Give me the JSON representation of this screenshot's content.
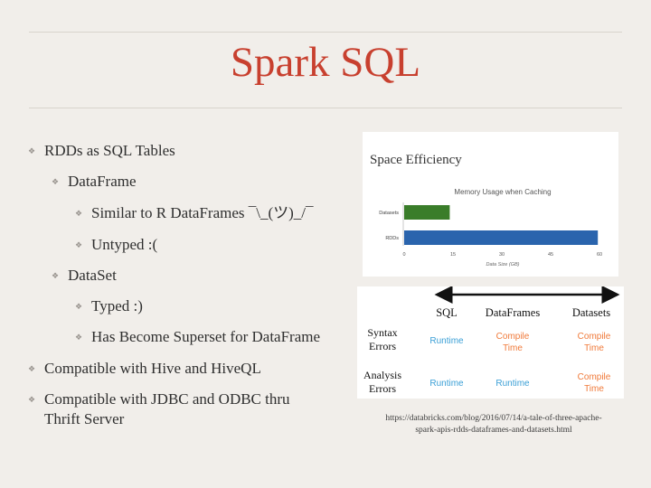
{
  "slide": {
    "title": "Spark SQL",
    "bullets": [
      {
        "text": "RDDs as SQL Tables"
      },
      {
        "text": "DataFrame"
      },
      {
        "text": "Similar to R DataFrames ¯\\_(ツ)_/¯"
      },
      {
        "text": "Untyped :("
      },
      {
        "text": "DataSet"
      },
      {
        "text": "Typed :)"
      },
      {
        "text": "Has Become Superset for DataFrame"
      },
      {
        "text": "Compatible with Hive and HiveQL"
      },
      {
        "text": "Compatible with JDBC and ODBC thru",
        "text2": "Thrift Server"
      }
    ],
    "source_url_line1": "https://databricks.com/blog/2016/07/14/a-tale-of-three-apache-",
    "source_url_line2": "spark-apis-rdds-dataframes-and-datasets.html"
  },
  "chart_data": {
    "type": "bar",
    "orientation": "horizontal",
    "panel_title": "Space Efficiency",
    "title": "Memory Usage when Caching",
    "xlabel": "Data Size (GB)",
    "ylabel": "",
    "categories": [
      "Datasets",
      "RDDs"
    ],
    "values": [
      14,
      59.5
    ],
    "colors": [
      "#3a7d2a",
      "#2a64ad"
    ],
    "xlim": [
      0,
      60
    ],
    "xticks": [
      0,
      15,
      30,
      45,
      60
    ],
    "grid": false
  },
  "comparison": {
    "columns": [
      "SQL",
      "DataFrames",
      "Datasets"
    ],
    "rows": [
      {
        "label": [
          "Syntax",
          "Errors"
        ],
        "cells": [
          [
            "Runtime"
          ],
          [
            "Compile",
            "Time"
          ],
          [
            "Compile",
            "Time"
          ]
        ]
      },
      {
        "label": [
          "Analysis",
          "Errors"
        ],
        "cells": [
          [
            "Runtime"
          ],
          [
            "Runtime"
          ],
          [
            "Compile",
            "Time"
          ]
        ]
      }
    ],
    "colors": {
      "runtime": "#3a9fd6",
      "compile": "#f07a3a",
      "arrow": "#111111"
    }
  }
}
